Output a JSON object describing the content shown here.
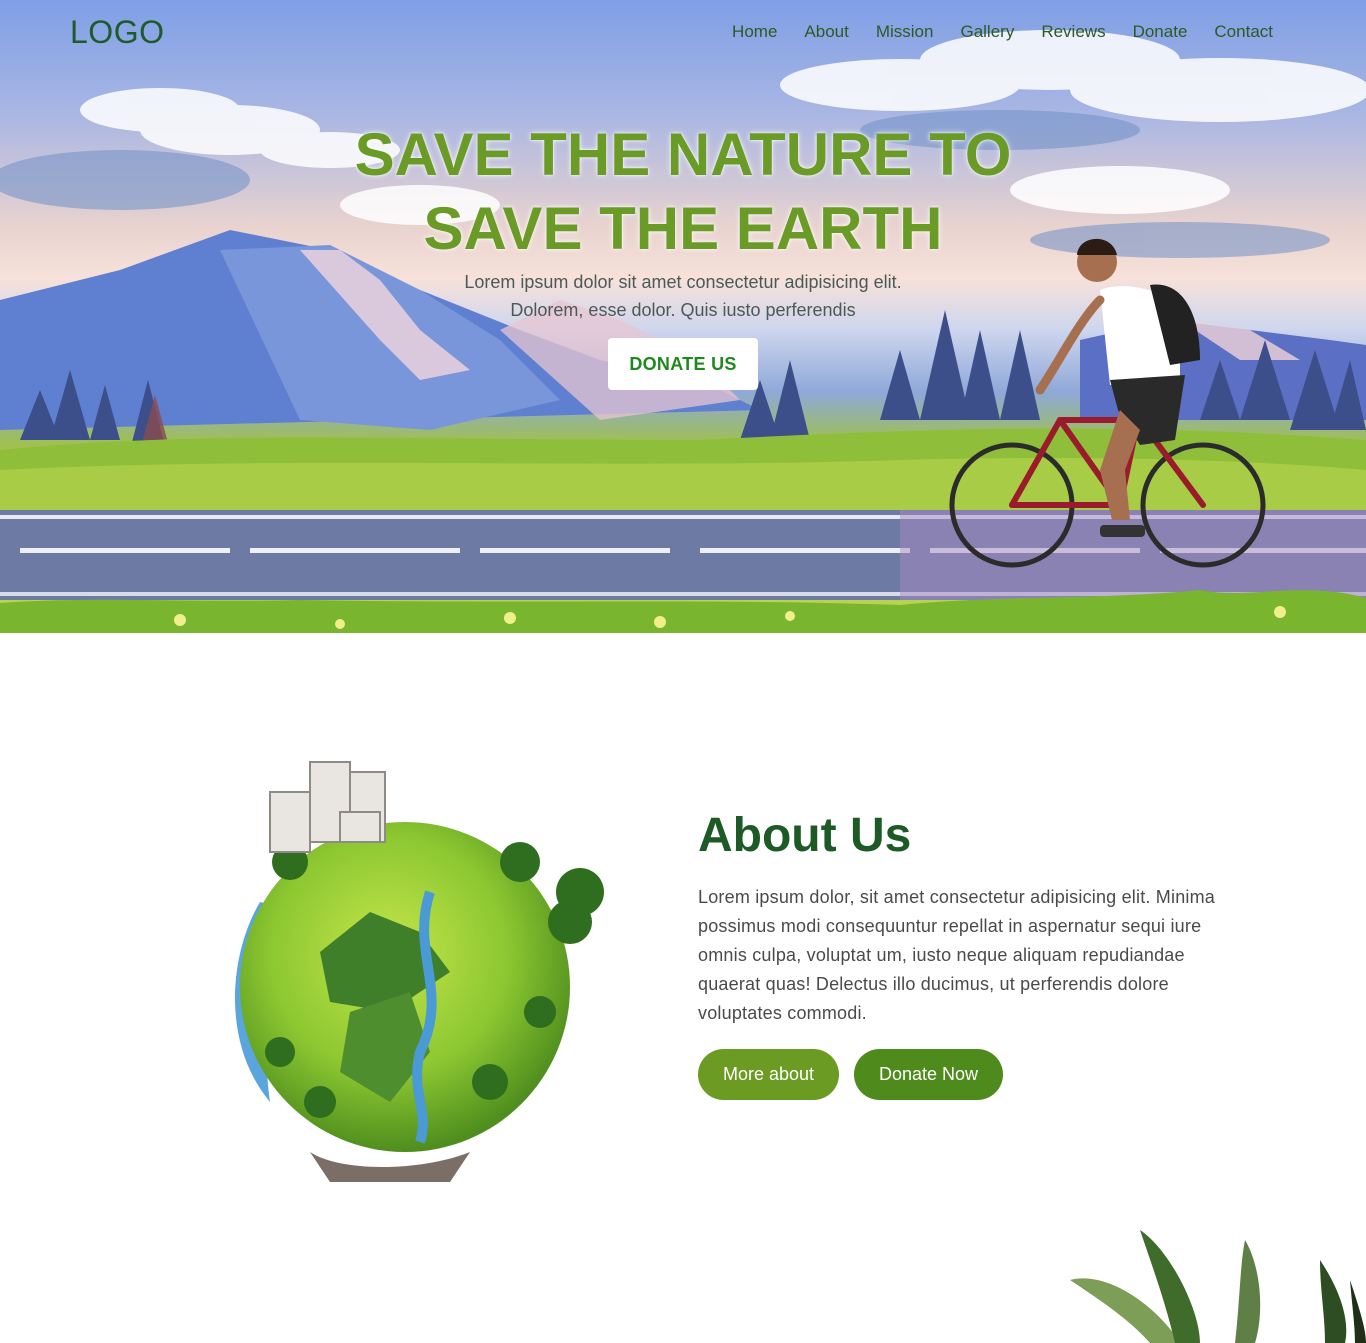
{
  "nav": {
    "logo": "LOGO",
    "items": [
      {
        "label": "Home"
      },
      {
        "label": "About"
      },
      {
        "label": "Mission"
      },
      {
        "label": "Gallery"
      },
      {
        "label": "Reviews"
      },
      {
        "label": "Donate"
      },
      {
        "label": "Contact"
      }
    ]
  },
  "hero": {
    "title_line1": "SAVE THE NATURE TO",
    "title_line2": "SAVE THE EARTH",
    "subtitle_line1": "Lorem ipsum dolor sit amet consectetur adipisicing elit.",
    "subtitle_line2": "Dolorem, esse dolor. Quis iusto perferendis",
    "cta_label": "DONATE US"
  },
  "about": {
    "title": "About Us",
    "text": "Lorem ipsum dolor, sit amet consectetur adipisicing elit. Minima possimus modi consequuntur repellat in aspernatur sequi iure omnis culpa, voluptat um, iusto neque aliquam repudiandae quaerat quas! Delectus illo ducimus, ut perferendis dolore voluptates commodi.",
    "more_label": "More about",
    "donate_label": "Donate Now"
  },
  "colors": {
    "brand_green": "#1e5a25",
    "accent_green": "#6b9b22",
    "hero_title": "#6a9b26"
  },
  "icons": {
    "hero_image": "mountain-landscape-cyclist-illustration",
    "about_image": "green-planet-illustration",
    "corner_decoration": "leaves-decoration"
  }
}
